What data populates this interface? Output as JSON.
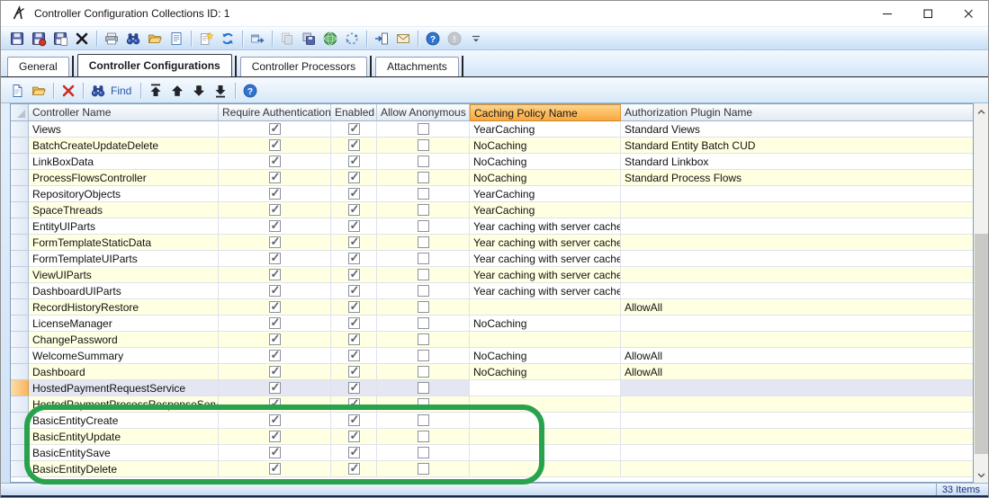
{
  "titlebar": {
    "title": "Controller Configuration Collections ID: 1"
  },
  "colors": {
    "sorted_header_orange": "#faa73e",
    "row_alternate": "#ffffe1",
    "row_selected": "#e4e6f1",
    "selected_gutter_orange": "#f9b45c",
    "annotation_green": "#28a24c"
  },
  "main_toolbar": {
    "items": [
      {
        "name": "save-button",
        "icon": "floppy-icon"
      },
      {
        "name": "save-and-close-button",
        "icon": "floppy-red-dot-icon"
      },
      {
        "name": "save-and-new-button",
        "icon": "floppy-page-icon"
      },
      {
        "name": "delete-button",
        "icon": "black-x-icon"
      },
      {
        "type": "sep"
      },
      {
        "name": "print-button",
        "icon": "printer-icon"
      },
      {
        "name": "find-button",
        "icon": "binoculars-icon"
      },
      {
        "name": "open-button",
        "icon": "open-folder-icon"
      },
      {
        "name": "preview-button",
        "icon": "document-icon"
      },
      {
        "type": "sep"
      },
      {
        "name": "wizard-button",
        "icon": "sparkle-page-icon"
      },
      {
        "name": "refresh-button",
        "icon": "refresh-arrows-icon"
      },
      {
        "type": "sep"
      },
      {
        "name": "popout-button",
        "icon": "window-arrow-icon"
      },
      {
        "type": "sep"
      },
      {
        "name": "copy-records-button",
        "icon": "grey-disks-icon",
        "disabled": true
      },
      {
        "name": "save-records-button",
        "icon": "disks-icon"
      },
      {
        "name": "web-button",
        "icon": "globe-icon"
      },
      {
        "name": "sync-button",
        "icon": "circular-dots-icon"
      },
      {
        "type": "sep"
      },
      {
        "name": "import-button",
        "icon": "import-arrow-icon"
      },
      {
        "name": "send-button",
        "icon": "envelope-icon"
      },
      {
        "type": "sep"
      },
      {
        "name": "help-button",
        "icon": "question-circle-icon"
      },
      {
        "name": "about-button",
        "icon": "exclamation-circle-icon",
        "disabled": true
      },
      {
        "name": "toolbar-overflow-button",
        "icon": "chevron-down-icon"
      }
    ]
  },
  "tabs": {
    "items": [
      {
        "label": "General",
        "active": false
      },
      {
        "label": "Controller Configurations",
        "active": true
      },
      {
        "label": "Controller Processors",
        "active": false
      },
      {
        "label": "Attachments",
        "active": false
      }
    ]
  },
  "grid_toolbar": {
    "items": [
      {
        "name": "add-row-button",
        "icon": "new-page-icon"
      },
      {
        "name": "open-row-button",
        "icon": "open-folder-icon"
      },
      {
        "type": "sep"
      },
      {
        "name": "delete-row-button",
        "icon": "red-x-icon"
      },
      {
        "type": "sep"
      },
      {
        "name": "find-rows-button",
        "icon": "binoculars-icon",
        "label": "Find"
      },
      {
        "type": "sep"
      },
      {
        "name": "move-first-button",
        "icon": "arrow-up-bar-icon"
      },
      {
        "name": "move-up-button",
        "icon": "arrow-up-icon"
      },
      {
        "name": "move-down-button",
        "icon": "arrow-down-icon"
      },
      {
        "name": "move-last-button",
        "icon": "arrow-down-bar-icon"
      },
      {
        "type": "sep"
      },
      {
        "name": "grid-help-button",
        "icon": "question-circle-icon"
      }
    ]
  },
  "grid": {
    "columns": [
      {
        "label": "Controller Name"
      },
      {
        "label": "Require Authentication",
        "type": "check"
      },
      {
        "label": "Enabled",
        "type": "check"
      },
      {
        "label": "Allow Anonymous",
        "type": "check"
      },
      {
        "label": "Caching Policy Name",
        "sorted": true
      },
      {
        "label": "Authorization Plugin Name"
      }
    ],
    "rows": [
      {
        "name": "Views",
        "require_auth": true,
        "enabled": true,
        "allow_anonymous": false,
        "caching": "YearCaching",
        "auth_plugin": "Standard Views",
        "selected": false
      },
      {
        "name": "BatchCreateUpdateDelete",
        "require_auth": true,
        "enabled": true,
        "allow_anonymous": false,
        "caching": "NoCaching",
        "auth_plugin": "Standard Entity Batch CUD",
        "selected": false
      },
      {
        "name": "LinkBoxData",
        "require_auth": true,
        "enabled": true,
        "allow_anonymous": false,
        "caching": "NoCaching",
        "auth_plugin": "Standard Linkbox",
        "selected": false
      },
      {
        "name": "ProcessFlowsController",
        "require_auth": true,
        "enabled": true,
        "allow_anonymous": false,
        "caching": "NoCaching",
        "auth_plugin": "Standard Process Flows",
        "selected": false
      },
      {
        "name": "RepositoryObjects",
        "require_auth": true,
        "enabled": true,
        "allow_anonymous": false,
        "caching": "YearCaching",
        "auth_plugin": "",
        "selected": false
      },
      {
        "name": "SpaceThreads",
        "require_auth": true,
        "enabled": true,
        "allow_anonymous": false,
        "caching": "YearCaching",
        "auth_plugin": "",
        "selected": false
      },
      {
        "name": "EntityUIParts",
        "require_auth": true,
        "enabled": true,
        "allow_anonymous": false,
        "caching": "Year caching with server cache",
        "auth_plugin": "",
        "selected": false
      },
      {
        "name": "FormTemplateStaticData",
        "require_auth": true,
        "enabled": true,
        "allow_anonymous": false,
        "caching": "Year caching with server cache",
        "auth_plugin": "",
        "selected": false
      },
      {
        "name": "FormTemplateUIParts",
        "require_auth": true,
        "enabled": true,
        "allow_anonymous": false,
        "caching": "Year caching with server cache",
        "auth_plugin": "",
        "selected": false
      },
      {
        "name": "ViewUIParts",
        "require_auth": true,
        "enabled": true,
        "allow_anonymous": false,
        "caching": "Year caching with server cache",
        "auth_plugin": "",
        "selected": false
      },
      {
        "name": "DashboardUIParts",
        "require_auth": true,
        "enabled": true,
        "allow_anonymous": false,
        "caching": "Year caching with server cache",
        "auth_plugin": "",
        "selected": false
      },
      {
        "name": "RecordHistoryRestore",
        "require_auth": true,
        "enabled": true,
        "allow_anonymous": false,
        "caching": "",
        "auth_plugin": "AllowAll",
        "selected": false
      },
      {
        "name": "LicenseManager",
        "require_auth": true,
        "enabled": true,
        "allow_anonymous": false,
        "caching": "NoCaching",
        "auth_plugin": "",
        "selected": false
      },
      {
        "name": "ChangePassword",
        "require_auth": true,
        "enabled": true,
        "allow_anonymous": false,
        "caching": "",
        "auth_plugin": "",
        "selected": false
      },
      {
        "name": "WelcomeSummary",
        "require_auth": true,
        "enabled": true,
        "allow_anonymous": false,
        "caching": "NoCaching",
        "auth_plugin": "AllowAll",
        "selected": false
      },
      {
        "name": "Dashboard",
        "require_auth": true,
        "enabled": true,
        "allow_anonymous": false,
        "caching": "NoCaching",
        "auth_plugin": "AllowAll",
        "selected": false
      },
      {
        "name": "HostedPaymentRequestService",
        "require_auth": true,
        "enabled": true,
        "allow_anonymous": false,
        "caching": "",
        "auth_plugin": "",
        "selected": true
      },
      {
        "name": "HostedPaymentProcessResponseService",
        "require_auth": true,
        "enabled": true,
        "allow_anonymous": false,
        "caching": "",
        "auth_plugin": "",
        "selected": false
      },
      {
        "name": "BasicEntityCreate",
        "require_auth": true,
        "enabled": true,
        "allow_anonymous": false,
        "caching": "",
        "auth_plugin": "",
        "selected": false
      },
      {
        "name": "BasicEntityUpdate",
        "require_auth": true,
        "enabled": true,
        "allow_anonymous": false,
        "caching": "",
        "auth_plugin": "",
        "selected": false
      },
      {
        "name": "BasicEntitySave",
        "require_auth": true,
        "enabled": true,
        "allow_anonymous": false,
        "caching": "",
        "auth_plugin": "",
        "selected": false
      },
      {
        "name": "BasicEntityDelete",
        "require_auth": true,
        "enabled": true,
        "allow_anonymous": false,
        "caching": "",
        "auth_plugin": "",
        "selected": false
      }
    ]
  },
  "statusbar": {
    "items_count": "33 Items"
  },
  "annotation": {
    "shape": "rounded-rect",
    "color": "#28a24c",
    "purpose": "highlights BasicEntity rows"
  }
}
